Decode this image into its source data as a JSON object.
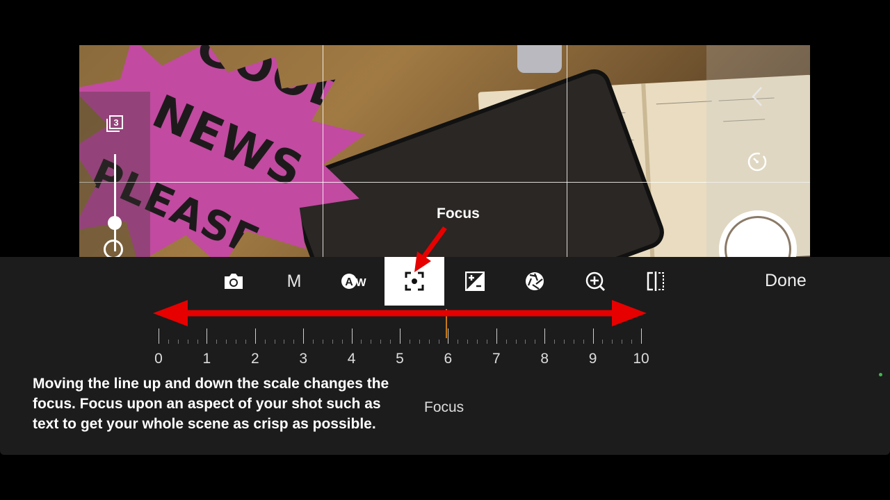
{
  "toolbar": {
    "modes": [
      {
        "name": "camera",
        "icon": "camera-icon"
      },
      {
        "name": "manual",
        "label": "M"
      },
      {
        "name": "auto-white-balance",
        "label": "AW"
      },
      {
        "name": "focus",
        "icon": "focus-icon",
        "active": true
      },
      {
        "name": "exposure",
        "icon": "exposure-icon"
      },
      {
        "name": "aperture",
        "icon": "aperture-icon"
      },
      {
        "name": "zoom",
        "icon": "zoom-in-icon"
      },
      {
        "name": "compare",
        "icon": "split-icon"
      }
    ],
    "done_label": "Done"
  },
  "focus_scale": {
    "labels": [
      "0",
      "1",
      "2",
      "3",
      "4",
      "5",
      "6",
      "7",
      "8",
      "9",
      "10"
    ],
    "current_value": 5.95,
    "title": "Focus"
  },
  "annotation": {
    "callout_label": "Focus",
    "caption": "Moving the line up and down the scale changes the focus. Focus upon an aspect of your shot such as text to get your whole scene as crisp as possible."
  },
  "viewfinder": {
    "burst_words": [
      "GOOD",
      "NEWS",
      "PLEASE"
    ],
    "stack_count": "3"
  },
  "colors": {
    "annotation_red": "#e60000",
    "panel": "#1c1c1c",
    "focus_marker": "#c97a1a"
  }
}
